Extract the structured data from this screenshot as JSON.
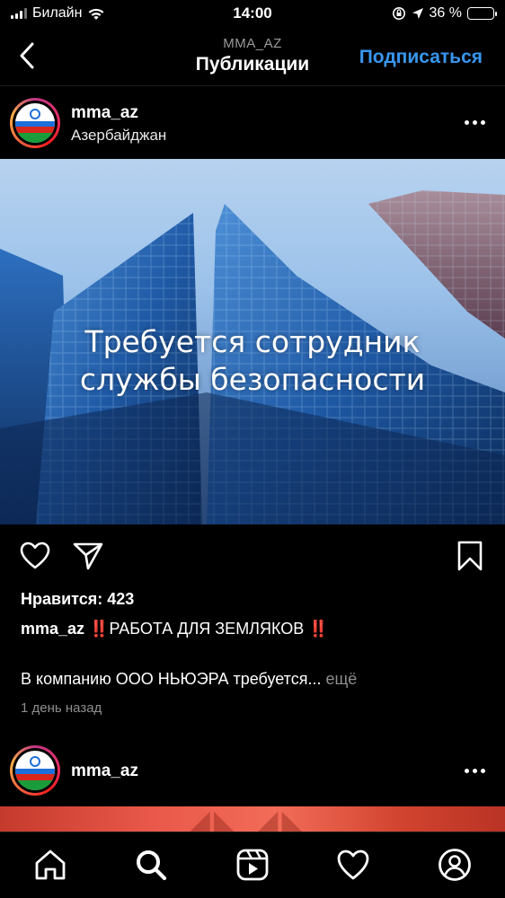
{
  "status_bar": {
    "carrier": "Билайн",
    "time": "14:00",
    "battery_percent": "36 %",
    "battery_level": 0.36,
    "icons": [
      "signal-icon",
      "wifi-icon",
      "orientation-lock-icon",
      "location-icon",
      "battery-icon"
    ]
  },
  "header": {
    "subtitle": "MMA_AZ",
    "title": "Публикации",
    "follow_label": "Подписаться",
    "back_icon": "chevron-left-icon"
  },
  "post": {
    "username": "mma_az",
    "location": "Азербайджан",
    "image_text_line1": "Требуется сотрудник",
    "image_text_line2": "службы безопасности",
    "likes": "Нравится: 423",
    "caption_username": "mma_az",
    "caption_bang": "‼️",
    "caption_text": "РАБОТА ДЛЯ ЗЕМЛЯКОВ",
    "caption_bang_end": "‼️",
    "body_text": "В компанию ООО НЬЮЭРА требуется...",
    "more_label": "ещё",
    "time_ago": "1 день назад",
    "action_icons": [
      "heart-icon",
      "share-icon",
      "bookmark-icon"
    ]
  },
  "next_post": {
    "username": "mma_az"
  },
  "tab_bar": {
    "tabs": [
      "home",
      "search",
      "reels",
      "activity",
      "profile"
    ],
    "active": "search"
  },
  "colors": {
    "background": "#000000",
    "accent": "#3897f0",
    "secondary_text": "#8e8e8e"
  }
}
